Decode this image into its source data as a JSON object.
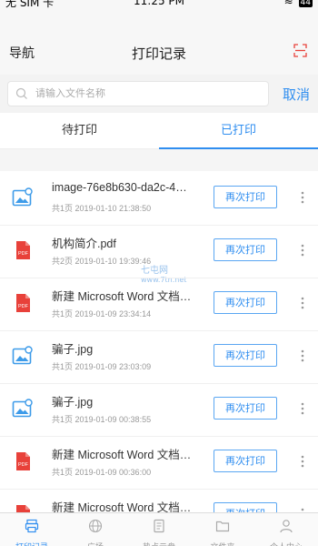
{
  "status_bar": {
    "carrier": "无 SIM 卡",
    "time": "11:25 PM",
    "battery": "44"
  },
  "nav": {
    "left_label": "导航",
    "title": "打印记录",
    "scan_icon": "scan-icon"
  },
  "search": {
    "placeholder": "请输入文件名称",
    "value": "",
    "cancel_label": "取消"
  },
  "tabs": [
    {
      "label": "待打印",
      "active": false
    },
    {
      "label": "已打印",
      "active": true
    }
  ],
  "records": [
    {
      "type": "image",
      "name": "image-76e8b630-da2c-4…",
      "meta": "共1页 2019-01-10 21:38:50",
      "action": "再次打印"
    },
    {
      "type": "pdf",
      "name": "机构简介.pdf",
      "meta": "共2页 2019-01-10 19:39:46",
      "action": "再次打印"
    },
    {
      "type": "pdf",
      "name": "新建 Microsoft Word 文档…",
      "meta": "共1页 2019-01-09 23:34:14",
      "action": "再次打印"
    },
    {
      "type": "image",
      "name": "骗子.jpg",
      "meta": "共1页 2019-01-09 23:03:09",
      "action": "再次打印"
    },
    {
      "type": "image",
      "name": "骗子.jpg",
      "meta": "共1页 2019-01-09 00:38:55",
      "action": "再次打印"
    },
    {
      "type": "pdf",
      "name": "新建 Microsoft Word 文档…",
      "meta": "共1页 2019-01-09 00:36:00",
      "action": "再次打印"
    },
    {
      "type": "pdf",
      "name": "新建 Microsoft Word 文档…",
      "meta": "",
      "action": "再次打印"
    }
  ],
  "watermark": {
    "line1": "七屯网",
    "line2": "www.7tn.net"
  },
  "tabbar": [
    {
      "label": "打印记录",
      "icon": "printer-icon",
      "active": true
    },
    {
      "label": "广场",
      "icon": "globe-icon",
      "active": false
    },
    {
      "label": "热点云盘",
      "icon": "document-icon",
      "active": false
    },
    {
      "label": "文件夹",
      "icon": "folder-icon",
      "active": false
    },
    {
      "label": "个人中心",
      "icon": "person-icon",
      "active": false
    }
  ],
  "colors": {
    "accent": "#2f8ef0",
    "pdf": "#e8413a",
    "image_icon": "#3d9be9"
  }
}
